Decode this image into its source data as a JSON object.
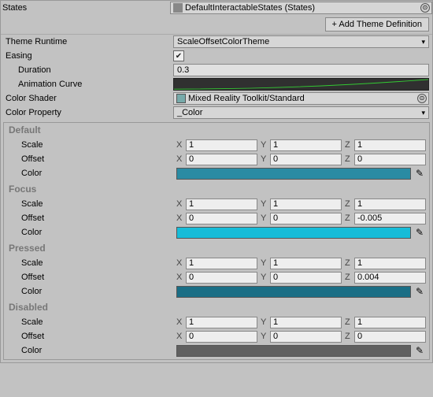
{
  "top": {
    "states_label": "States",
    "states_value": "DefaultInteractableStates (States)",
    "add_theme_button": "+ Add Theme Definition"
  },
  "runtime": {
    "theme_runtime_label": "Theme Runtime",
    "theme_runtime_value": "ScaleOffsetColorTheme",
    "easing_label": "Easing",
    "duration_label": "Duration",
    "duration_value": "0.3",
    "animation_curve_label": "Animation Curve",
    "color_shader_label": "Color Shader",
    "color_shader_value": "Mixed Reality Toolkit/Standard",
    "color_property_label": "Color Property",
    "color_property_value": "_Color"
  },
  "states": [
    {
      "name": "Default",
      "scale_label": "Scale",
      "scale": {
        "x": "1",
        "y": "1",
        "z": "1"
      },
      "offset_label": "Offset",
      "offset": {
        "x": "0",
        "y": "0",
        "z": "0"
      },
      "color_label": "Color",
      "color": "#2a8ba3"
    },
    {
      "name": "Focus",
      "scale_label": "Scale",
      "scale": {
        "x": "1",
        "y": "1",
        "z": "1"
      },
      "offset_label": "Offset",
      "offset": {
        "x": "0",
        "y": "0",
        "z": "-0.005"
      },
      "color_label": "Color",
      "color": "#17bcd8"
    },
    {
      "name": "Pressed",
      "scale_label": "Scale",
      "scale": {
        "x": "1",
        "y": "1",
        "z": "1"
      },
      "offset_label": "Offset",
      "offset": {
        "x": "0",
        "y": "0",
        "z": "0.004"
      },
      "color_label": "Color",
      "color": "#1a6e85"
    },
    {
      "name": "Disabled",
      "scale_label": "Scale",
      "scale": {
        "x": "1",
        "y": "1",
        "z": "1"
      },
      "offset_label": "Offset",
      "offset": {
        "x": "0",
        "y": "0",
        "z": "0"
      },
      "color_label": "Color",
      "color": "#606060"
    }
  ],
  "axes": {
    "x": "X",
    "y": "Y",
    "z": "Z"
  }
}
